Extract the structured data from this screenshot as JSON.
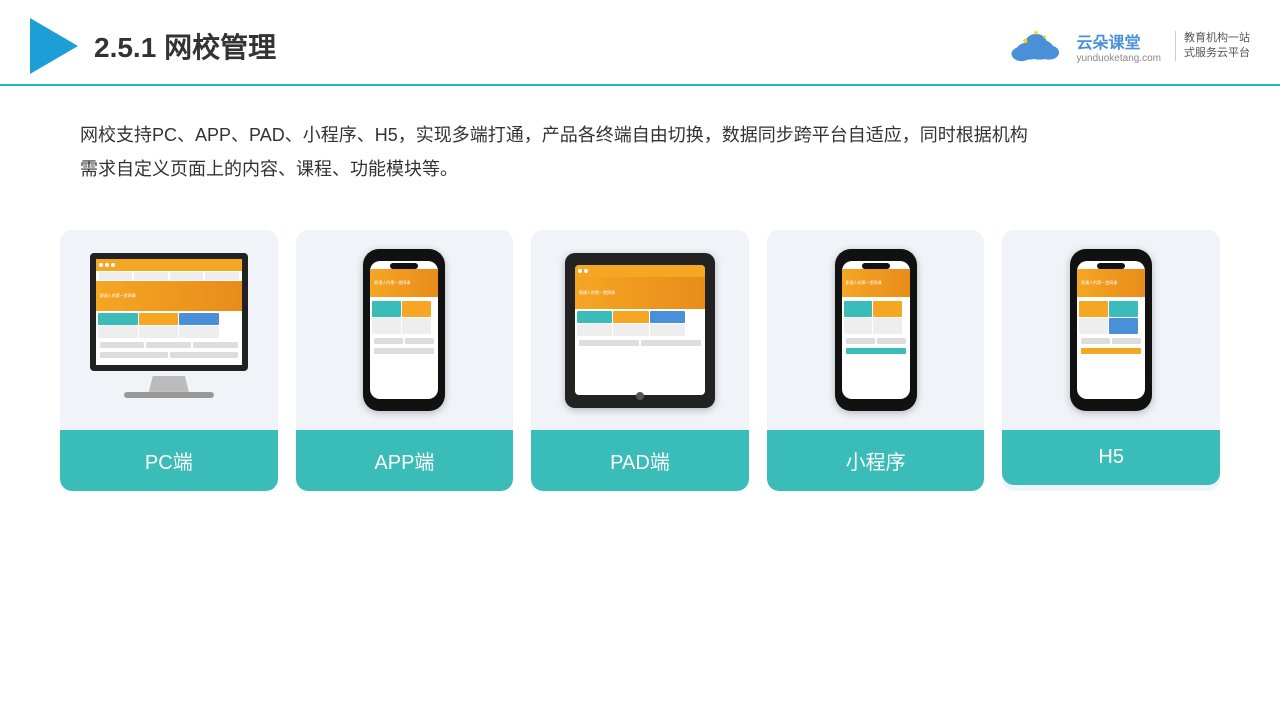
{
  "header": {
    "section_number": "2.5.1",
    "title": "网校管理",
    "logo_name": "云朵课堂",
    "logo_en": "yunduoketang.com",
    "logo_slogan_line1": "教育机构一站",
    "logo_slogan_line2": "式服务云平台"
  },
  "description": {
    "text": "网校支持PC、APP、PAD、小程序、H5，实现多端打通，产品各终端自由切换，数据同步跨平台自适应，同时根据机构",
    "text2": "需求自定义页面上的内容、课程、功能模块等。"
  },
  "cards": [
    {
      "id": "pc",
      "label": "PC端"
    },
    {
      "id": "app",
      "label": "APP端"
    },
    {
      "id": "pad",
      "label": "PAD端"
    },
    {
      "id": "miniapp",
      "label": "小程序"
    },
    {
      "id": "h5",
      "label": "H5"
    }
  ],
  "accent_color": "#3ABCB8",
  "text_color": "#333"
}
